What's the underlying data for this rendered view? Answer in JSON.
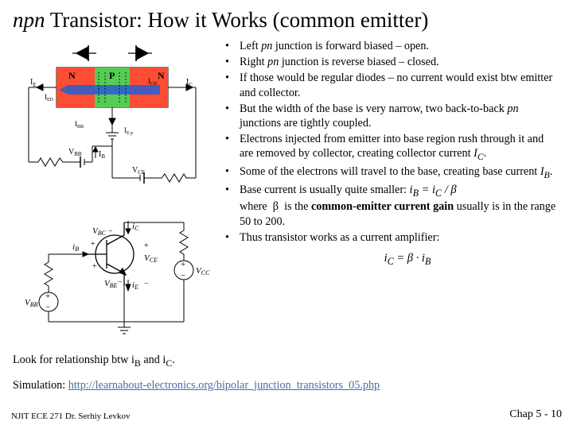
{
  "title": {
    "pre": "npn",
    "mid": " Transistor: How it Works ",
    "paren": "(common emitter)"
  },
  "bullets": [
    "Left <i>pn</i> junction is forward biased – open.",
    "Right <i>pn</i> junction is reverse biased – closed.",
    "If those would be regular diodes – no current would exist btw emitter and collector.",
    "But the width of the base is very narrow, two back-to-back <i>pn</i> junctions are tightly coupled.",
    "Electrons injected from emitter into base region rush through it and are removed by collector, creating collector current <i>I<sub>C</sub></i>.",
    "Some of the electrons will travel to the base, creating base current <i>I<sub>B</sub></i>.",
    "Base current is usually quite smaller: <span class=\"eqimg\">i<sub>B</sub> = i<sub>C</sub> / β</span><br>where &nbsp;<span class=\"greek\">β</span>&nbsp; is the <b>common-emitter current gain</b> usually is in the range 50 to 200.",
    "Thus transistor works as a current amplifier:"
  ],
  "final_eq": "i<sub>C</sub> = β · i<sub>B</sub>",
  "lookfor": "Look  for relationship btw i<sub>B</sub> and i<sub>C</sub>.",
  "sim_label": "Simulation: ",
  "sim_url_text": "http://learnabout-electronics.org/bipolar_junction_transistors_05.php",
  "footer_left": "NJIT  ECE 271  Dr. Serhiy Levkov",
  "footer_right_pre": "Chap 5 - ",
  "footer_right_num": "10",
  "fig1": {
    "N_left": "N",
    "P": "P",
    "N_right": "N",
    "IE": "I",
    "IE_sub": "E",
    "IED": "I",
    "IED_sub": "ED",
    "ICD": "I",
    "ICD_sub": "CD",
    "IC": "I",
    "IC_sub": "C",
    "IEp": "I",
    "IEp_sub": "E p",
    "IBB": "I",
    "IBB_sub": "BB",
    "VBB": "V",
    "VBB_sub": "BB",
    "IB": "I",
    "IB_sub": "B",
    "VCE": "V",
    "VCE_sub": "CE"
  },
  "fig2": {
    "iB": "i",
    "iB_sub": "B",
    "iE": "i",
    "iE_sub": "E",
    "iC": "i",
    "iC_sub": "C",
    "VBB": "V",
    "VBB_sub": "BB",
    "VBC": "V",
    "VBC_sub": "BC",
    "VBE": "V",
    "VBE_sub": "BE",
    "VCE": "V",
    "VCE_sub": "CE",
    "VCC": "V",
    "VCC_sub": "CC"
  }
}
